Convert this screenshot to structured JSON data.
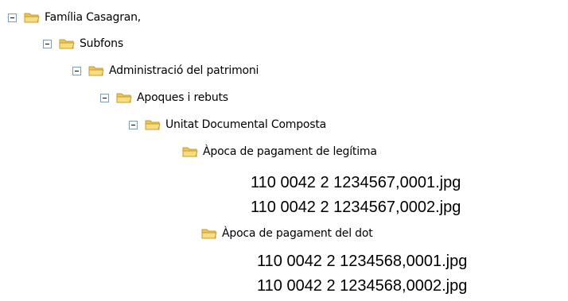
{
  "tree": {
    "root": "Família Casagran,",
    "subfons": "Subfons",
    "admin": "Administració del patrimoni",
    "apoques": "Apoques i rebuts",
    "unitat": "Unitat Documental Composta",
    "apoca1": "Àpoca de pagament de legítima",
    "apoca2": "Àpoca de pagament del dot"
  },
  "files": {
    "f1": "110 0042 2 1234567,0001.jpg",
    "f2": "110 0042 2 1234567,0002.jpg",
    "f3": "110 0042 2 1234568,0001.jpg",
    "f4": "110 0042 2 1234568,0002.jpg"
  },
  "colors": {
    "folder_fill": "#f3d679",
    "folder_stroke": "#c89b2e",
    "toggle_border": "#7f9db9"
  }
}
